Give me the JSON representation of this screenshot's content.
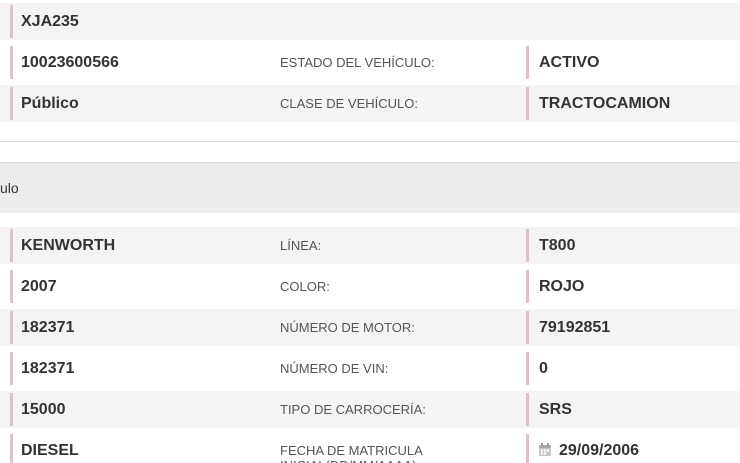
{
  "top_section": {
    "plate": "XJA235",
    "row2": {
      "left_value": "10023600566",
      "label": "ESTADO DEL VEHÍCULO:",
      "right_value": "ACTIVO"
    },
    "row3": {
      "left_value": "Público",
      "label": "CLASE DE VEHÍCULO:",
      "right_value": "TRACTOCAMION"
    }
  },
  "section_title": "ulo",
  "details": {
    "rows": [
      {
        "left_value": "KENWORTH",
        "label": "LÍNEA:",
        "right_value": "T800"
      },
      {
        "left_value": "2007",
        "label": "COLOR:",
        "right_value": "ROJO"
      },
      {
        "left_value": "182371",
        "label": "NÚMERO DE MOTOR:",
        "right_value": "79192851"
      },
      {
        "left_value": "182371",
        "label": "NÚMERO DE VIN:",
        "right_value": "0"
      },
      {
        "left_value": "15000",
        "label": "TIPO DE CARROCERÍA:",
        "right_value": "SRS"
      },
      {
        "left_value": "DIESEL",
        "label": "FECHA DE MATRICULA INICIAL(DD/MM/AAAA):",
        "right_value": "29/09/2006"
      }
    ]
  },
  "icons": {
    "date_icon": "calendar-icon"
  },
  "colors": {
    "row_shade": "#f4f4f4",
    "accent_bar": "#dcc4c6",
    "section_header": "#ececec"
  }
}
